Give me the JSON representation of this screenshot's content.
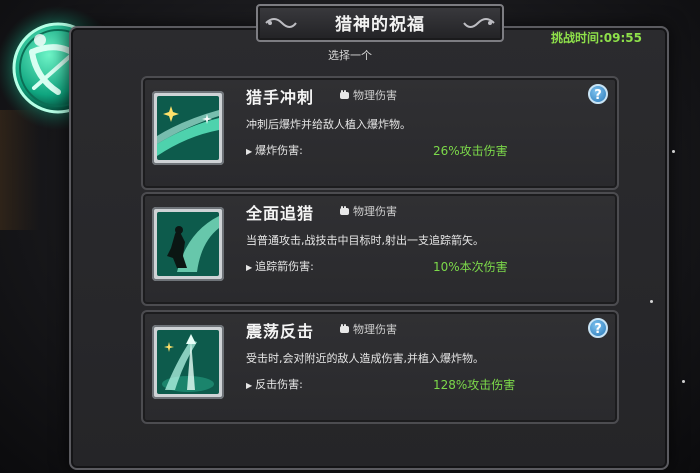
{
  "header": {
    "title": "猎神的祝福",
    "subtitle": "选择一个",
    "timer": "挑战时间:09:55"
  },
  "damage_type_icon": "fist-icon",
  "cards": [
    {
      "name": "猎手冲刺",
      "damage_type": "物理伤害",
      "description": "冲刺后爆炸并给敌人植入爆炸物。",
      "stat_label": "爆炸伤害:",
      "stat_value": "26%攻击伤害",
      "has_help": true,
      "icon": "dash-skill-icon"
    },
    {
      "name": "全面追猎",
      "damage_type": "物理伤害",
      "description": "当普通攻击,战技击中目标时,射出一支追踪箭矢。",
      "stat_label": "追踪箭伤害:",
      "stat_value": "10%本次伤害",
      "has_help": false,
      "icon": "hunter-silhouette-icon"
    },
    {
      "name": "震荡反击",
      "damage_type": "物理伤害",
      "description": "受击时,会对附近的敌人造成伤害,并植入爆炸物。",
      "stat_label": "反击伤害:",
      "stat_value": "128%攻击伤害",
      "has_help": true,
      "icon": "counter-arrows-icon"
    }
  ],
  "help_symbol": "?",
  "colors": {
    "accent_green": "#7cd94a",
    "timer_green": "#8ee04a",
    "emblem_teal": "#1fd0a0",
    "help_blue": "#2a79b8"
  }
}
